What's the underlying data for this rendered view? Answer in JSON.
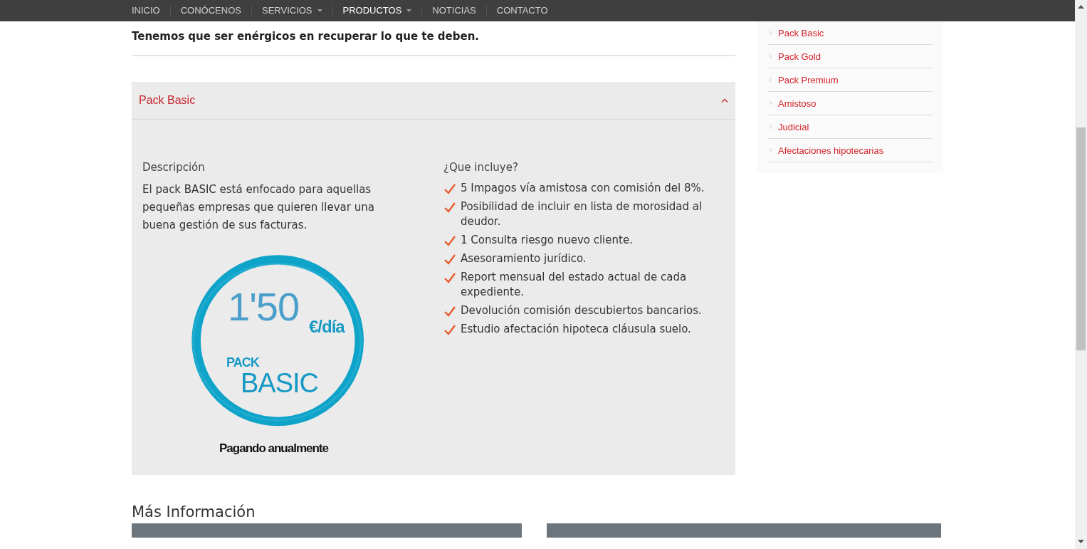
{
  "nav": {
    "items": [
      {
        "label": "INICIO",
        "dropdown": false,
        "selected": false
      },
      {
        "label": "CONÓCENOS",
        "dropdown": false,
        "selected": false
      },
      {
        "label": "SERVICIOS",
        "dropdown": true,
        "selected": false
      },
      {
        "label": "PRODUCTOS",
        "dropdown": true,
        "selected": true
      },
      {
        "label": "NOTICIAS",
        "dropdown": false,
        "selected": false
      },
      {
        "label": "CONTACTO",
        "dropdown": false,
        "selected": false
      }
    ]
  },
  "headline": "Tenemos que ser enérgicos en recuperar lo que te deben.",
  "accordion": {
    "title": "Pack Basic",
    "expanded": true,
    "description_title": "Descripción",
    "description": "El pack BASIC está enfocado para aquellas pequeñas empresas que quieren llevar una buena gestión de sus facturas.",
    "badge": {
      "price": "1'50",
      "unit": "€/día",
      "pack": "PACK",
      "name": "BASIC",
      "note": "Pagando anualmente"
    },
    "includes_title": "¿Que incluye?",
    "includes": [
      "5 Impagos vía amistosa con comisión del 8%.",
      "Posibilidad de incluir en lista de morosidad al deudor.",
      "1 Consulta riesgo nuevo cliente.",
      "Asesoramiento jurídico.",
      "Report mensual del estado actual de cada expediente.",
      "Devolución comisión descubiertos bancarios.",
      "Estudio afectación hipoteca cláusula suelo."
    ]
  },
  "more_info": {
    "title": "Más Información"
  },
  "sidebar": {
    "items": [
      "Pack Basic",
      "Pack Gold",
      "Pack Premium",
      "Amistoso",
      "Judicial",
      "Afectaciones hipotecarias"
    ]
  }
}
